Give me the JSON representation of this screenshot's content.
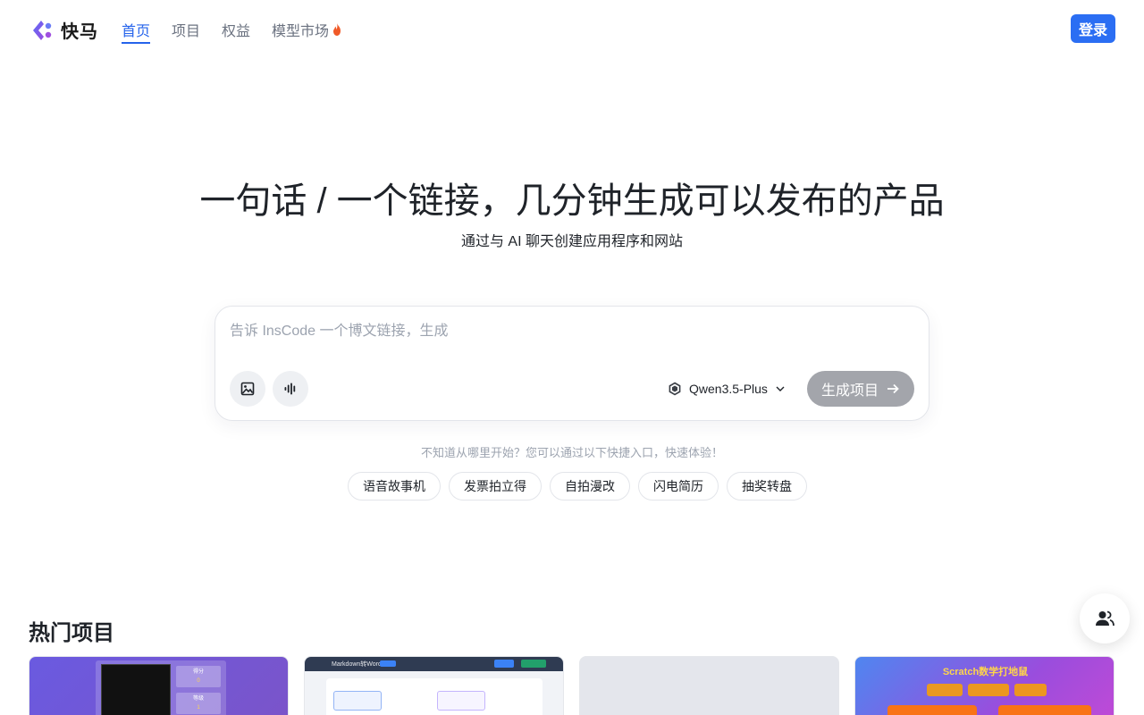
{
  "header": {
    "brand": "快马",
    "nav": [
      {
        "label": "首页",
        "active": true
      },
      {
        "label": "项目",
        "active": false
      },
      {
        "label": "权益",
        "active": false
      },
      {
        "label": "模型市场",
        "active": false,
        "icon": "fire-icon"
      }
    ],
    "login_label": "登录"
  },
  "hero": {
    "title": "一句话 / 一个链接，几分钟生成可以发布的产品",
    "subtitle": "通过与 AI 聊天创建应用程序和网站"
  },
  "prompt": {
    "placeholder": "告诉 InsCode 一个博文链接，生成",
    "value": "",
    "image_button_icon": "image-icon",
    "voice_button_icon": "voice-icon",
    "model": "Qwen3.5-Plus",
    "generate_label": "生成项目"
  },
  "hint": "不知道从哪里开始？您可以通过以下快捷入口，快速体验！",
  "chips": [
    "语音故事机",
    "发票拍立得",
    "自拍漫改",
    "闪电简历",
    "抽奖转盘"
  ],
  "popular": {
    "title": "热门项目",
    "cards": [
      {
        "preview_labels": [
          "得分",
          "0",
          "等级",
          "1"
        ]
      },
      {
        "preview_labels": [
          "Markdown转Word"
        ]
      },
      {
        "preview_labels": []
      },
      {
        "preview_labels": [
          "Scratch数学打地鼠"
        ]
      }
    ]
  },
  "colors": {
    "accent": "#2563eb",
    "login_bg": "#2b6ef3",
    "generate_bg": "#a3a5ab"
  }
}
